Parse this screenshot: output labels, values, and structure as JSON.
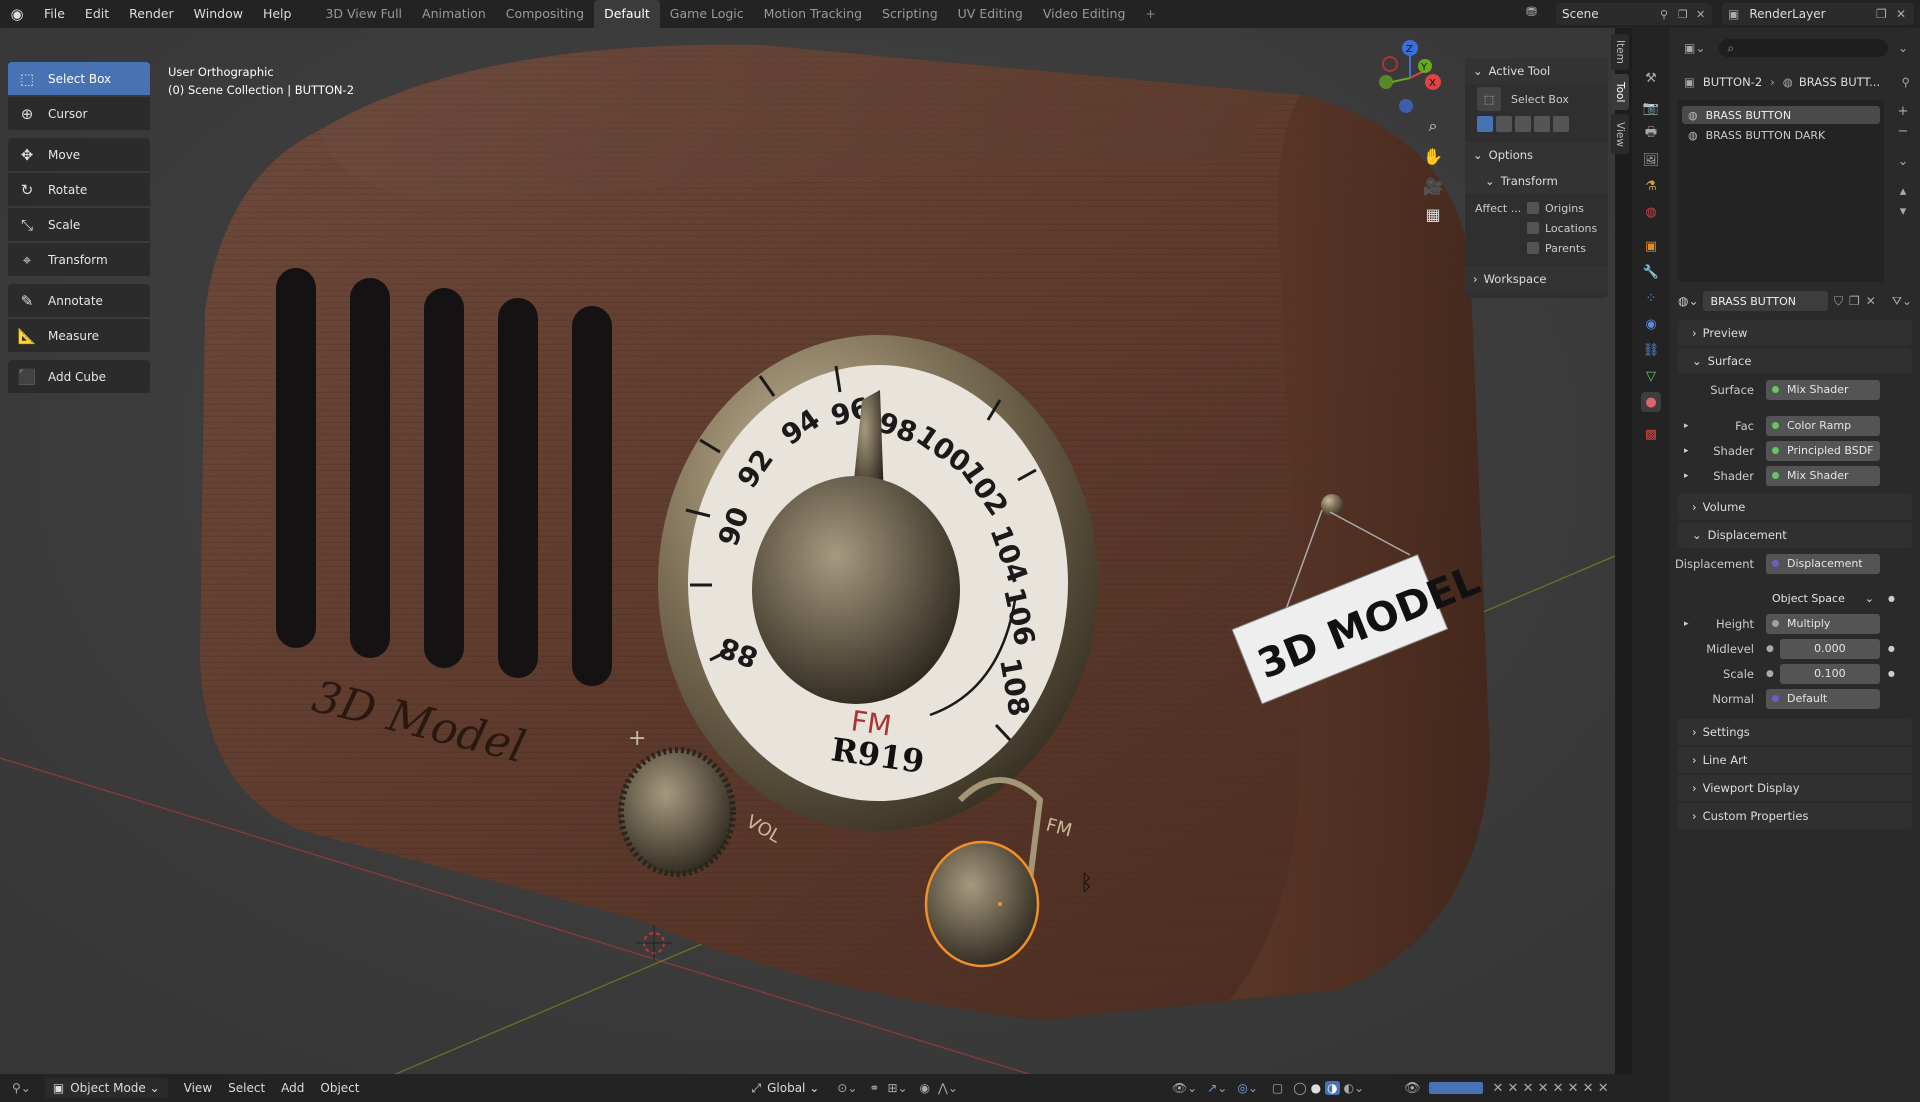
{
  "menu": [
    "File",
    "Edit",
    "Render",
    "Window",
    "Help"
  ],
  "workspaces": [
    "3D View Full",
    "Animation",
    "Compositing",
    "Default",
    "Game Logic",
    "Motion Tracking",
    "Scripting",
    "UV Editing",
    "Video Editing"
  ],
  "scene_name": "Scene",
  "render_layer": "RenderLayer",
  "tools": [
    {
      "label": "Select Box",
      "icon": "select-box-icon"
    },
    {
      "label": "Cursor",
      "icon": "cursor-icon"
    },
    {
      "label": "Move",
      "icon": "move-icon"
    },
    {
      "label": "Rotate",
      "icon": "rotate-icon"
    },
    {
      "label": "Scale",
      "icon": "scale-icon"
    },
    {
      "label": "Transform",
      "icon": "transform-icon"
    },
    {
      "label": "Annotate",
      "icon": "annotate-icon"
    },
    {
      "label": "Measure",
      "icon": "measure-icon"
    },
    {
      "label": "Add Cube",
      "icon": "add-cube-icon"
    }
  ],
  "viewport": {
    "view_name": "User Orthographic",
    "collection": "(0) Scene Collection | BUTTON-2"
  },
  "gizmo": {
    "z": "Z",
    "y": "Y",
    "x": "X"
  },
  "model_text": {
    "brand": "3D Model",
    "sign": "3D MODEL",
    "model": "R919",
    "band": "FM",
    "vol": "VOL",
    "fm_label": "FM",
    "plus": "+"
  },
  "dial_numbers": [
    "90",
    "92",
    "94",
    "96",
    "98",
    "100",
    "102",
    "104",
    "106",
    "108",
    "88"
  ],
  "npanel": {
    "active_tool_title": "Active Tool",
    "tool_name": "Select Box",
    "options_title": "Options",
    "transform_title": "Transform",
    "affect_label": "Affect ...",
    "checks": [
      "Origins",
      "Locations",
      "Parents"
    ],
    "workspace_title": "Workspace",
    "tabs": [
      "Item",
      "Tool",
      "View"
    ]
  },
  "bottom": {
    "mode": "Object Mode",
    "menus": [
      "View",
      "Select",
      "Add",
      "Object"
    ],
    "orientation": "Global"
  },
  "props": {
    "breadcrumb_obj": "BUTTON-2",
    "breadcrumb_mat": "BRASS BUTT...",
    "materials": [
      "BRASS BUTTON",
      "BRASS BUTTON DARK"
    ],
    "material_name": "BRASS BUTTON",
    "sections": {
      "preview": "Preview",
      "surface": "Surface",
      "volume": "Volume",
      "displacement": "Displacement",
      "settings": "Settings",
      "line_art": "Line Art",
      "viewport_display": "Viewport Display",
      "custom_props": "Custom Properties"
    },
    "surface_rows": [
      {
        "label": "Surface",
        "value": "Mix Shader",
        "expand": false
      },
      {
        "label": "Fac",
        "value": "Color Ramp",
        "expand": true
      },
      {
        "label": "Shader",
        "value": "Principled BSDF",
        "expand": true
      },
      {
        "label": "Shader",
        "value": "Mix Shader",
        "expand": true
      }
    ],
    "disp": {
      "disp_label": "Displacement",
      "disp_value": "Displacement",
      "space": "Object Space",
      "height_label": "Height",
      "height_value": "Multiply",
      "midlevel_label": "Midlevel",
      "midlevel_value": "0.000",
      "scale_label": "Scale",
      "scale_value": "0.100",
      "normal_label": "Normal",
      "normal_value": "Default"
    }
  }
}
